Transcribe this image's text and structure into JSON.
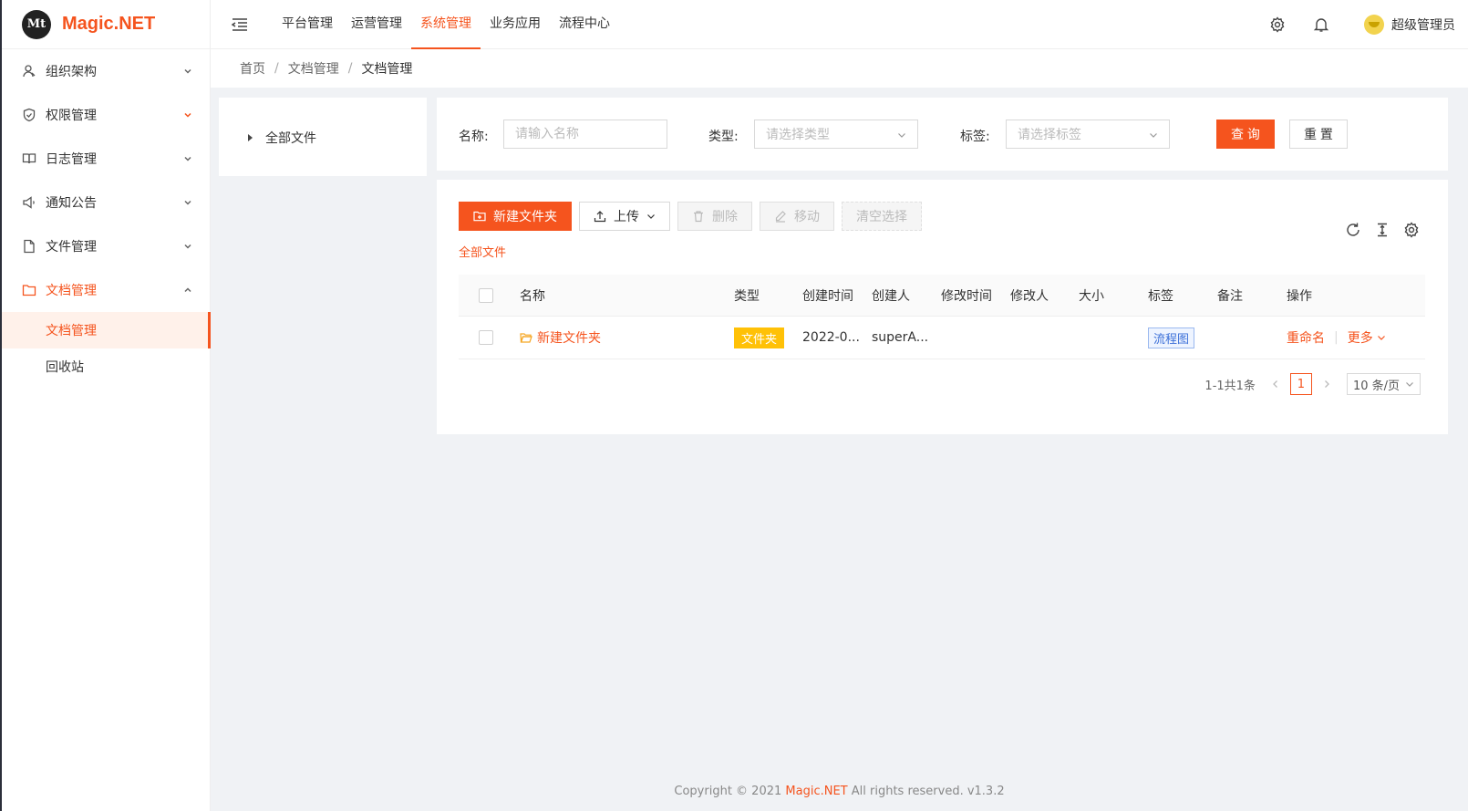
{
  "app": {
    "logo_mark": "Mt",
    "title": "Magic.NET"
  },
  "sidebar": {
    "items": [
      {
        "label": "组织架构",
        "icon": "user-icon"
      },
      {
        "label": "权限管理",
        "icon": "shield-icon"
      },
      {
        "label": "日志管理",
        "icon": "book-icon"
      },
      {
        "label": "通知公告",
        "icon": "speaker-icon"
      },
      {
        "label": "文件管理",
        "icon": "file-icon"
      },
      {
        "label": "文档管理",
        "icon": "folder-icon",
        "expanded": true
      }
    ],
    "sub_items": [
      {
        "label": "文档管理",
        "active": true
      },
      {
        "label": "回收站",
        "active": false
      }
    ]
  },
  "header": {
    "nav": [
      "平台管理",
      "运营管理",
      "系统管理",
      "业务应用",
      "流程中心"
    ],
    "active_nav": "系统管理",
    "username": "超级管理员"
  },
  "breadcrumb": {
    "home": "首页",
    "parent": "文档管理",
    "current": "文档管理"
  },
  "tree": {
    "root": "全部文件"
  },
  "search": {
    "name_label": "名称:",
    "name_placeholder": "请输入名称",
    "type_label": "类型:",
    "type_placeholder": "请选择类型",
    "tag_label": "标签:",
    "tag_placeholder": "请选择标签",
    "query_button": "查 询",
    "reset_button": "重 置"
  },
  "toolbar": {
    "new_folder": "新建文件夹",
    "upload": "上传",
    "delete": "删除",
    "move": "移动",
    "clear_selection": "清空选择",
    "current_path": "全部文件"
  },
  "table": {
    "columns": [
      "名称",
      "类型",
      "创建时间",
      "创建人",
      "修改时间",
      "修改人",
      "大小",
      "标签",
      "备注",
      "操作"
    ],
    "rows": [
      {
        "name": "新建文件夹",
        "type": "文件夹",
        "created": "2022-0...",
        "creator": "superA...",
        "modified": "",
        "modifier": "",
        "size": "",
        "tag": "流程图",
        "remark": "",
        "action_rename": "重命名",
        "action_more": "更多"
      }
    ]
  },
  "pagination": {
    "summary": "1-1共1条",
    "current_page": "1",
    "page_size": "10 条/页"
  },
  "footer": {
    "prefix": "Copyright © 2021 ",
    "brand": "Magic.NET",
    "suffix": " All rights reserved. v1.3.2"
  },
  "colors": {
    "accent": "#f5541e",
    "tag_yellow": "#ffc107",
    "tag_blue": "#3b6fd8"
  }
}
